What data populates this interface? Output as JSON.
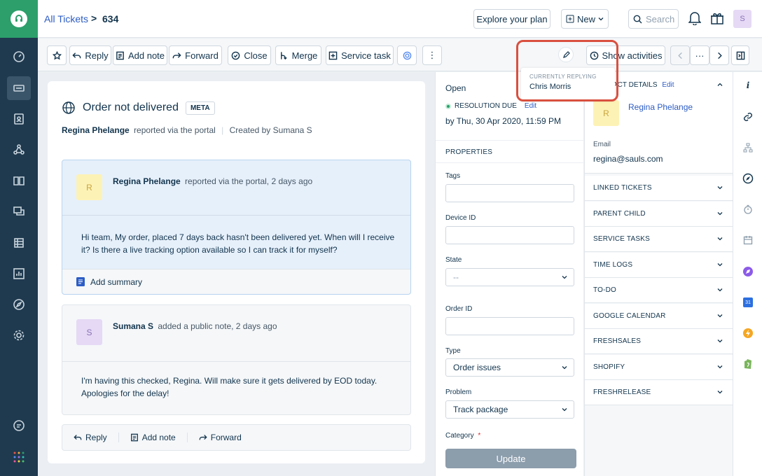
{
  "header": {
    "breadcrumb_link": "All Tickets",
    "breadcrumb_sep": ">",
    "ticket_id": "634",
    "explore_label": "Explore your plan",
    "new_label": "New",
    "search_placeholder": "Search",
    "avatar_initial": "S"
  },
  "toolbar": {
    "reply": "Reply",
    "add_note": "Add note",
    "forward": "Forward",
    "close": "Close",
    "merge": "Merge",
    "service_task": "Service task",
    "more": "⋮",
    "show_activities": "Show activities",
    "nav_more": "···"
  },
  "ticket": {
    "title": "Order not delivered",
    "tag": "META",
    "requester": "Regina Phelange",
    "via": "reported via the portal",
    "created_by": "Created by Sumana S"
  },
  "messages": [
    {
      "initial": "R",
      "author": "Regina Phelange",
      "action": "reported via the portal, 2 days ago",
      "body": "Hi team, My order, placed 7 days back hasn't been delivered yet. When will I receive it? Is there a live tracking option available so I can track it for myself?",
      "summary_label": "Add summary"
    },
    {
      "initial": "S",
      "author": "Sumana S",
      "action": "added a public note, 2 days ago",
      "body": "I'm having this checked, Regina. Will make sure it gets delivered by EOD today. Apologies for the delay!"
    }
  ],
  "reply_bar": {
    "reply": "Reply",
    "add_note": "Add note",
    "forward": "Forward"
  },
  "properties": {
    "status": "Open",
    "resolution_label": "RESOLUTION DUE",
    "edit": "Edit",
    "due_date": "by Thu, 30 Apr 2020, 11:59 PM",
    "heading": "PROPERTIES",
    "tags_label": "Tags",
    "device_label": "Device ID",
    "state_label": "State",
    "state_value": "--",
    "order_label": "Order ID",
    "type_label": "Type",
    "type_value": "Order issues",
    "problem_label": "Problem",
    "problem_value": "Track package",
    "category_label": "Category",
    "required_mark": "*",
    "update_label": "Update"
  },
  "contact": {
    "heading": "ACT DETAILS",
    "edit": "Edit",
    "initial": "R",
    "name": "Regina Phelange",
    "email_label": "Email",
    "email": "regina@sauls.com",
    "sections": [
      "LINKED TICKETS",
      "PARENT CHILD",
      "SERVICE TASKS",
      "TIME LOGS",
      "TO-DO",
      "GOOGLE CALENDAR",
      "FRESHSALES",
      "SHOPIFY",
      "FRESHRELEASE"
    ]
  },
  "popup": {
    "label": "CURRENTLY REPLYING",
    "name": "Chris Morris"
  },
  "rail": {
    "calendar_day": "31"
  },
  "colors": {
    "brand_green": "#2c9f6b",
    "nav_dark": "#1f3a4f",
    "link_blue": "#2c5cc5",
    "highlight_red": "#d9503f"
  }
}
